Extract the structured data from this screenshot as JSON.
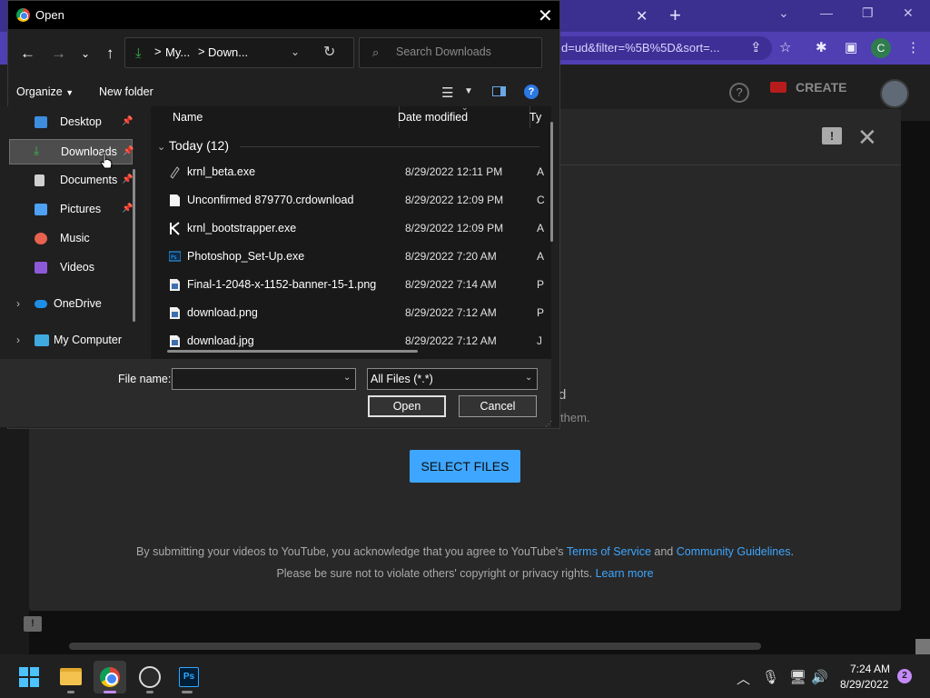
{
  "open_dialog": {
    "title": "Open",
    "address": {
      "crumbs": [
        "My...",
        "Down..."
      ],
      "separator": ">"
    },
    "search_placeholder": "Search Downloads",
    "command_bar": {
      "organize": "Organize",
      "new_folder": "New folder"
    },
    "nav_items": [
      {
        "label": "Desktop",
        "pinned": true
      },
      {
        "label": "Downloads",
        "pinned": true,
        "selected": true
      },
      {
        "label": "Documents",
        "pinned": true
      },
      {
        "label": "Pictures",
        "pinned": true
      },
      {
        "label": "Music",
        "pinned": false
      },
      {
        "label": "Videos",
        "pinned": false
      },
      {
        "label": "OneDrive",
        "expandable": true
      },
      {
        "label": "My Computer",
        "expandable": true
      }
    ],
    "columns": [
      "Name",
      "Date modified",
      "Ty"
    ],
    "group_header": "Today (12)",
    "files": [
      {
        "name": "krnl_beta.exe",
        "date": "8/29/2022 12:11 PM",
        "type": "A",
        "icon": "exe-generic-icon"
      },
      {
        "name": "Unconfirmed 879770.crdownload",
        "date": "8/29/2022 12:09 PM",
        "type": "C",
        "icon": "blank-file-icon"
      },
      {
        "name": "krnl_bootstrapper.exe",
        "date": "8/29/2022 12:09 PM",
        "type": "A",
        "icon": "krnl-app-icon"
      },
      {
        "name": "Photoshop_Set-Up.exe",
        "date": "8/29/2022 7:20 AM",
        "type": "A",
        "icon": "photoshop-file-icon"
      },
      {
        "name": "Final-1-2048-x-1152-banner-15-1.png",
        "date": "8/29/2022 7:14 AM",
        "type": "P",
        "icon": "image-file-icon"
      },
      {
        "name": "download.png",
        "date": "8/29/2022 7:12 AM",
        "type": "P",
        "icon": "image-file-icon"
      },
      {
        "name": "download.jpg",
        "date": "8/29/2022 7:12 AM",
        "type": "J",
        "icon": "image-file-icon"
      }
    ],
    "file_name_label": "File name:",
    "file_name_value": "",
    "file_type": "All Files (*.*)",
    "open_label": "Open",
    "cancel_label": "Cancel"
  },
  "browser": {
    "url_fragment": "d=ud&filter=%5B%5D&sort=...",
    "profile_initial": "C"
  },
  "youtube": {
    "create_label": "CREATE",
    "drag_title": "d",
    "drag_subtitle": "them.",
    "select_files_label": "SELECT FILES",
    "terms_prefix": "By submitting your videos to YouTube, you acknowledge that you agree to YouTube's ",
    "terms_link": "Terms of Service",
    "terms_and": " and ",
    "guidelines_link": "Community Guidelines",
    "terms_suffix": ".",
    "privacy_text": "Please be sure not to violate others' copyright or privacy rights. ",
    "learn_more": "Learn more"
  },
  "taskbar": {
    "time": "7:24 AM",
    "date": "8/29/2022",
    "notifications": "2",
    "apps": [
      "windows-start",
      "file-explorer",
      "chrome",
      "obs-studio",
      "photoshop"
    ]
  },
  "colors": {
    "chrome_frame": "#3b2f8f",
    "youtube_blue": "#3ea6ff",
    "dialog_bg": "#202020",
    "accent_download": "#37b24d"
  }
}
